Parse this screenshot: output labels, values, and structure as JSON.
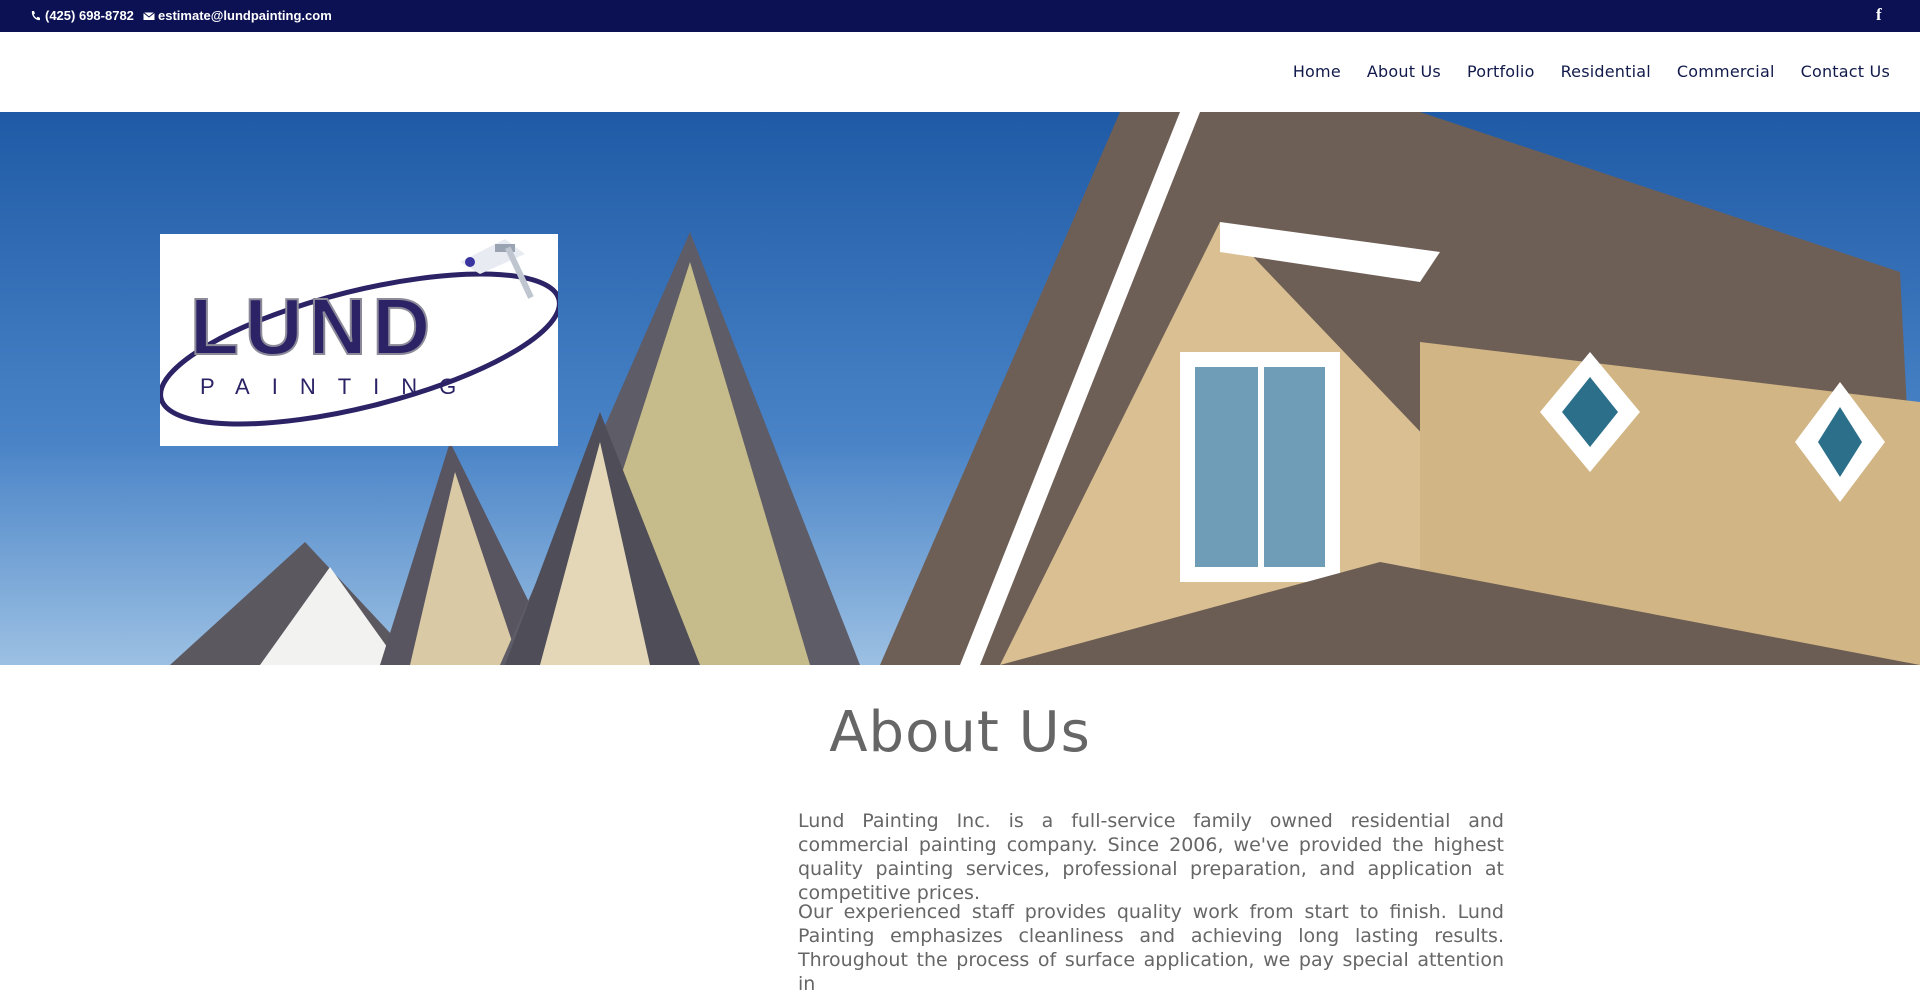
{
  "topbar": {
    "phone": "(425) 698-8782",
    "email": "estimate@lundpainting.com",
    "phone_icon": "phone-icon",
    "email_icon": "envelope-icon",
    "social_icon": "facebook-icon",
    "social_glyph": "f"
  },
  "nav": {
    "items": [
      {
        "label": "Home"
      },
      {
        "label": "About Us"
      },
      {
        "label": "Portfolio"
      },
      {
        "label": "Residential"
      },
      {
        "label": "Commercial"
      },
      {
        "label": "Contact Us"
      }
    ]
  },
  "logo": {
    "line1": "LUND",
    "line2": "PAINTING"
  },
  "main": {
    "title": "About Us",
    "paragraphs": [
      "Lund Painting Inc. is a full-service family owned residential and commercial painting company. Since 2006, we've provided the highest quality painting services, professional preparation, and application at competitive prices.",
      "Our experienced staff provides quality work from start to finish. Lund Painting emphasizes cleanliness and achieving long lasting results. Throughout the process of surface application, we pay special attention in"
    ]
  },
  "colors": {
    "topbar_bg": "#0c1153",
    "nav_text": "#111a4a",
    "body_text": "#666666",
    "logo_purple": "#2b2366"
  }
}
